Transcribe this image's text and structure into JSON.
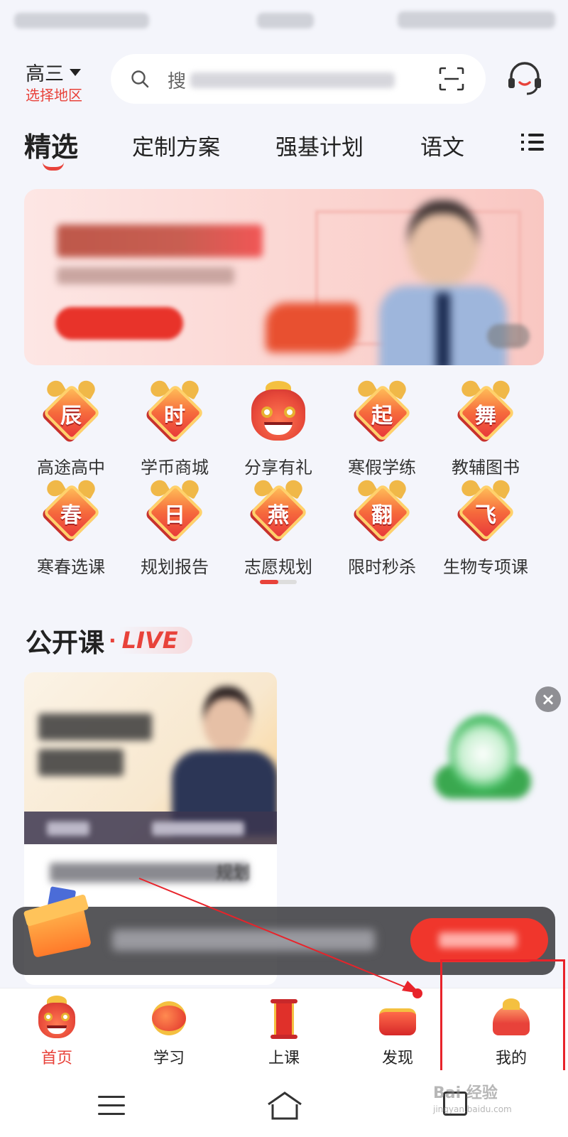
{
  "header": {
    "grade": "高三",
    "region": "选择地区",
    "search_placeholder_prefix": "搜"
  },
  "tabs": [
    {
      "label": "精选",
      "active": true
    },
    {
      "label": "定制方案"
    },
    {
      "label": "强基计划"
    },
    {
      "label": "语文"
    }
  ],
  "grid": {
    "row1": [
      {
        "char": "辰",
        "label": "高途高中",
        "icon": "dragon-diamond-icon"
      },
      {
        "char": "时",
        "label": "学币商城",
        "icon": "dragon-diamond-icon"
      },
      {
        "char": "",
        "label": "分享有礼",
        "icon": "dragon-head-icon"
      },
      {
        "char": "起",
        "label": "寒假学练",
        "icon": "dragon-diamond-icon"
      },
      {
        "char": "舞",
        "label": "教辅图书",
        "icon": "dragon-diamond-icon"
      }
    ],
    "row2": [
      {
        "char": "春",
        "label": "寒春选课",
        "icon": "dragon-diamond-icon"
      },
      {
        "char": "日",
        "label": "规划报告",
        "icon": "dragon-diamond-icon"
      },
      {
        "char": "燕",
        "label": "志愿规划",
        "icon": "dragon-diamond-icon"
      },
      {
        "char": "翻",
        "label": "限时秒杀",
        "icon": "dragon-diamond-icon"
      },
      {
        "char": "飞",
        "label": "生物专项课",
        "icon": "dragon-diamond-icon"
      }
    ]
  },
  "open_class": {
    "title": "公开课",
    "dot": "·",
    "live": "LIVE",
    "card_title_tail": "规划"
  },
  "close_symbol": "×",
  "bottom_nav": [
    {
      "label": "首页",
      "active": true
    },
    {
      "label": "学习"
    },
    {
      "label": "上课"
    },
    {
      "label": "发现"
    },
    {
      "label": "我的"
    }
  ],
  "watermark": {
    "text": "Bai 经验",
    "sub": "jingyan.baidu.com"
  },
  "colors": {
    "accent": "#e8423a",
    "annotation": "#e8232a"
  }
}
